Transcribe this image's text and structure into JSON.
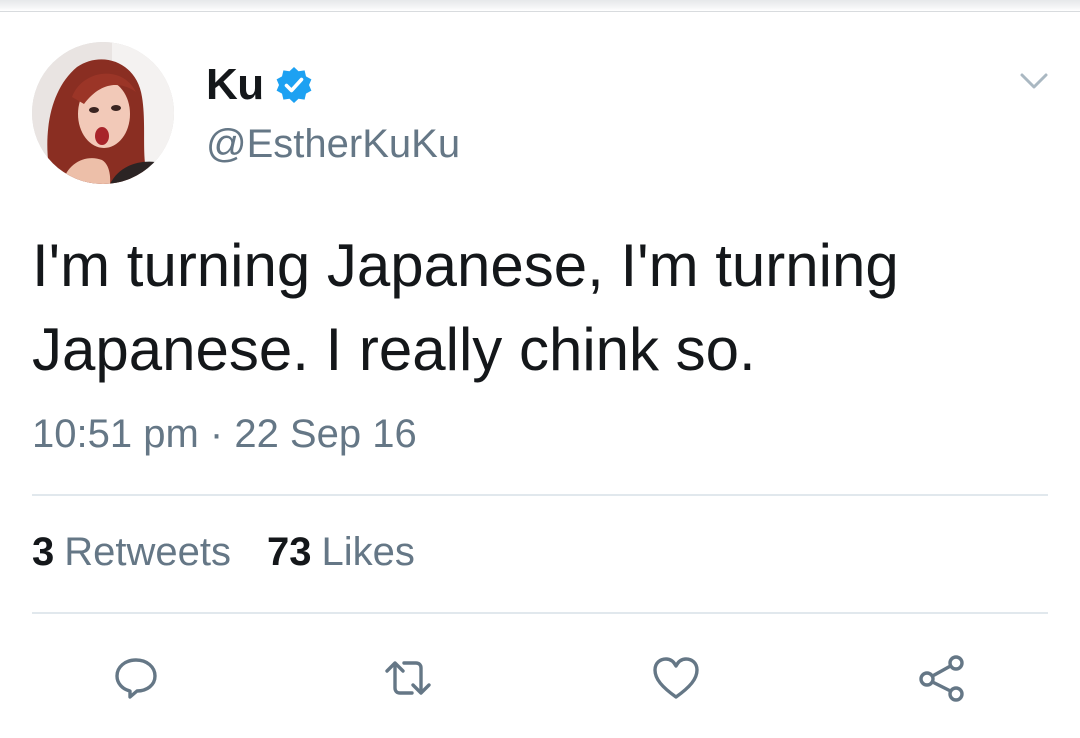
{
  "tweet": {
    "display_name": "Ku",
    "handle": "@EstherKuKu",
    "verified": true,
    "text": "I'm turning Japanese, I'm turning Japanese. I really chink so.",
    "timestamp": "10:51 pm · 22 Sep 16",
    "stats": {
      "retweets_count": "3",
      "retweets_label": "Retweets",
      "likes_count": "73",
      "likes_label": "Likes"
    }
  },
  "icons": {
    "verified": "verified-badge-icon",
    "menu": "chevron-down-icon",
    "reply": "reply-icon",
    "retweet": "retweet-icon",
    "like": "heart-icon",
    "share": "share-icon"
  },
  "colors": {
    "verified_blue": "#1da1f2",
    "text_primary": "#14171a",
    "text_secondary": "#657786",
    "divider": "#e1e8ed",
    "icon_gray": "#657786"
  }
}
